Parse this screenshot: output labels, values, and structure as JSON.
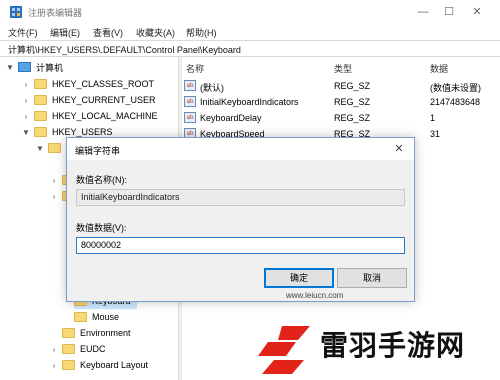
{
  "window": {
    "title": "注册表编辑器",
    "controls": {
      "minimize": "—",
      "maximize": "☐",
      "close": "✕"
    }
  },
  "menu": [
    "文件(F)",
    "编辑(E)",
    "查看(V)",
    "收藏夹(A)",
    "帮助(H)"
  ],
  "address": "计算机\\HKEY_USERS\\.DEFAULT\\Control Panel\\Keyboard",
  "tree": {
    "root": "计算机",
    "items": [
      "HKEY_CLASSES_ROOT",
      "HKEY_CURRENT_USER",
      "HKEY_LOCAL_MACHINE",
      "HKEY_USERS",
      "Keyboard",
      "Mouse",
      "Environment",
      "EUDC",
      "Keyboard Layout"
    ]
  },
  "list": {
    "headers": {
      "name": "名称",
      "type": "类型",
      "data": "数据"
    },
    "rows": [
      {
        "name": "(默认)",
        "type": "REG_SZ",
        "data": "(数值未设置)"
      },
      {
        "name": "InitialKeyboardIndicators",
        "type": "REG_SZ",
        "data": "2147483648"
      },
      {
        "name": "KeyboardDelay",
        "type": "REG_SZ",
        "data": "1"
      },
      {
        "name": "KeyboardSpeed",
        "type": "REG_SZ",
        "data": "31"
      }
    ]
  },
  "dialog": {
    "title": "编辑字符串",
    "name_label": "数值名称(N):",
    "name_value": "InitialKeyboardIndicators",
    "data_label": "数值数据(V):",
    "data_value": "80000002",
    "ok": "确定",
    "cancel": "取消"
  },
  "watermark": {
    "text": "雷羽手游网",
    "url": "www.leiucn.com"
  }
}
